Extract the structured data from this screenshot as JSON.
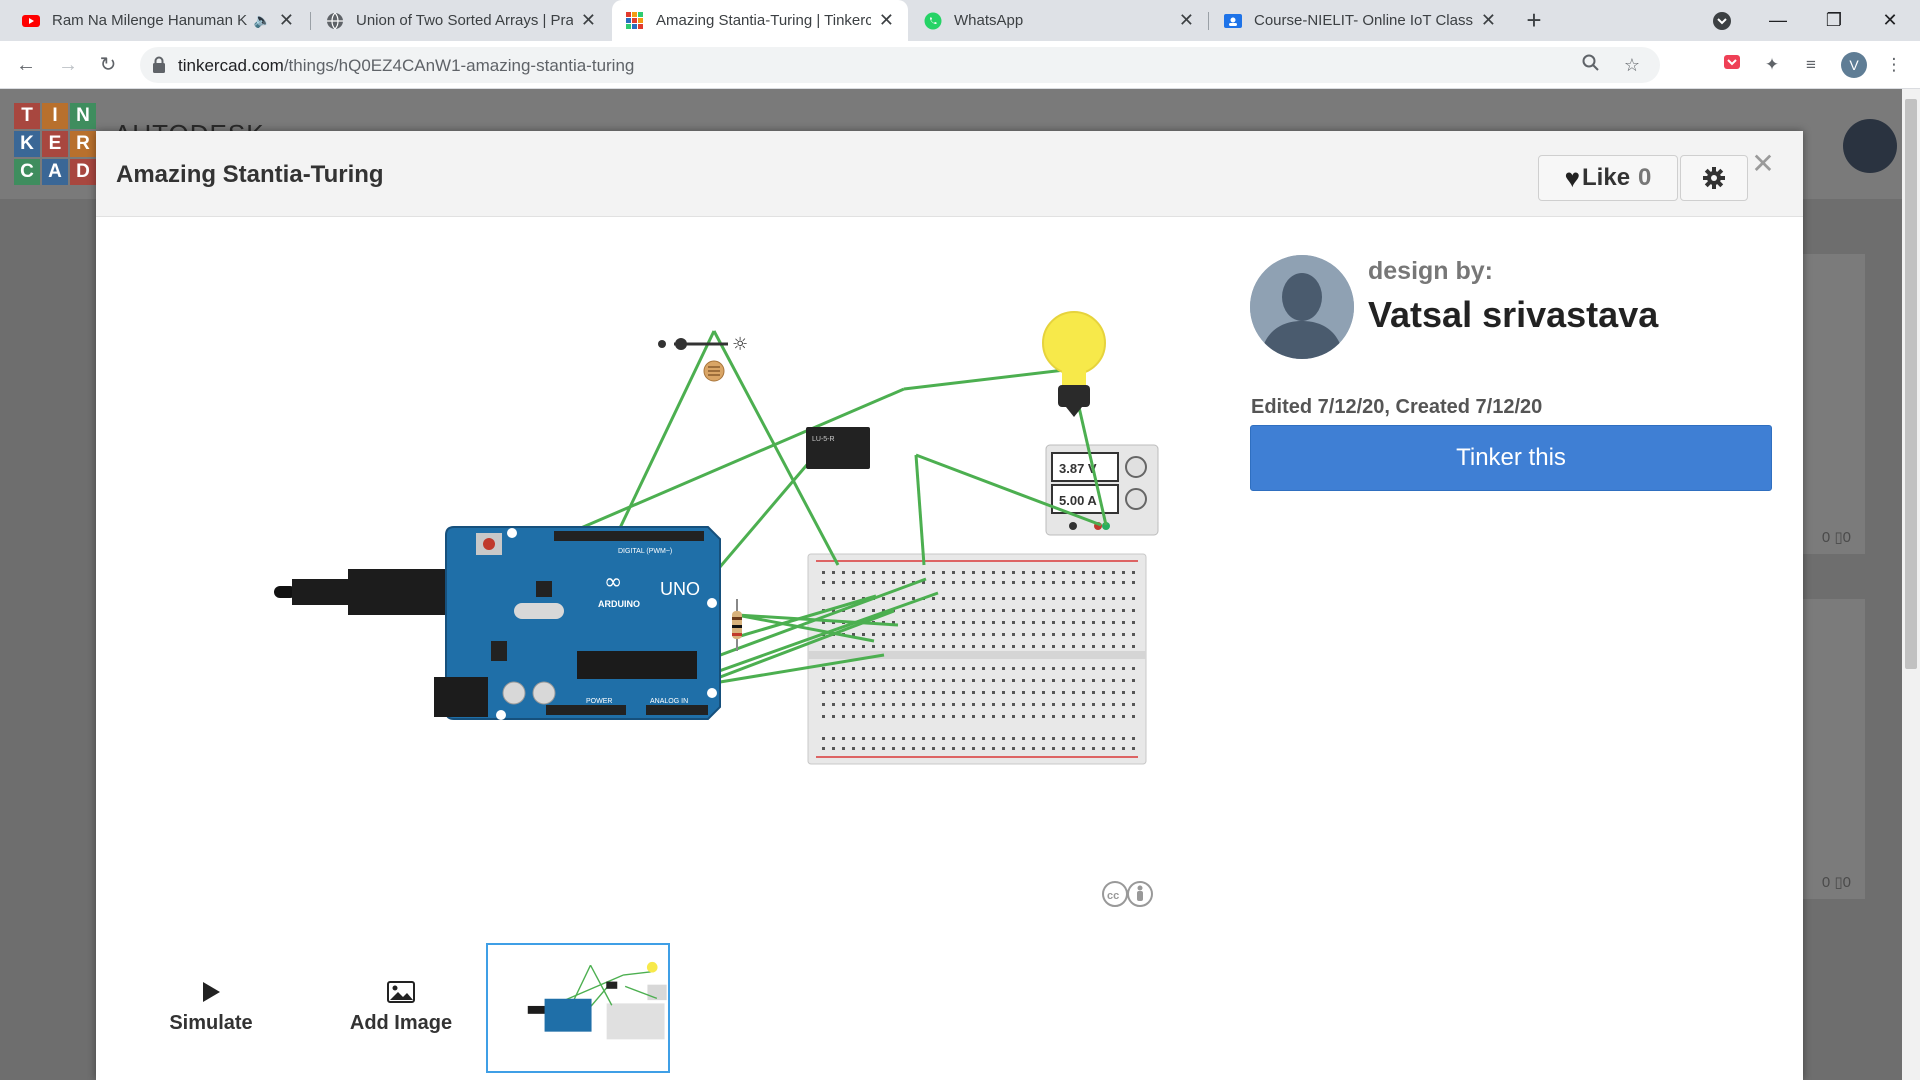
{
  "browser": {
    "tabs": [
      {
        "title": "Ram Na Milenge Hanuman K",
        "favicon": "youtube-icon",
        "audio": true
      },
      {
        "title": "Union of Two Sorted Arrays | Prac",
        "favicon": "globe-icon"
      },
      {
        "title": "Amazing Stantia-Turing | Tinkerca",
        "favicon": "tinkercad-icon",
        "active": true
      },
      {
        "title": "WhatsApp",
        "favicon": "whatsapp-icon"
      },
      {
        "title": "Course-NIELIT- Online IoT Class",
        "favicon": "classroom-icon"
      }
    ],
    "url_host": "tinkercad.com",
    "url_path": "/things/hQ0EZ4CAnW1-amazing-stantia-turing",
    "profile_initial": "V"
  },
  "background": {
    "logo_letters": [
      "T",
      "I",
      "N",
      "K",
      "E",
      "R",
      "C",
      "A",
      "D"
    ],
    "brand": "AUTODESK",
    "card_counts": [
      "0 ▯0",
      "0 ▯0"
    ]
  },
  "modal": {
    "title": "Amazing Stantia-Turing",
    "like_label": "Like",
    "like_count": "0",
    "design_by_label": "design by:",
    "author": "Vatsal srivastava",
    "edited_text": "Edited 7/12/20, Created 7/12/20",
    "tinker_button": "Tinker this",
    "simulate_label": "Simulate",
    "add_image_label": "Add Image"
  },
  "circuit": {
    "power_supply_voltage": "3.87 V",
    "power_supply_current": "5.00 A",
    "board_label": "UNO",
    "board_brand": "ARDUINO",
    "digital_header": "DIGITAL (PWM~)",
    "power_header": "POWER",
    "analog_header": "ANALOG IN",
    "relay_label": "LU-5-R"
  },
  "colors": {
    "accent_blue": "#3f7fd4",
    "wire_green": "#4caf50",
    "arduino_blue": "#1f6fa8"
  }
}
